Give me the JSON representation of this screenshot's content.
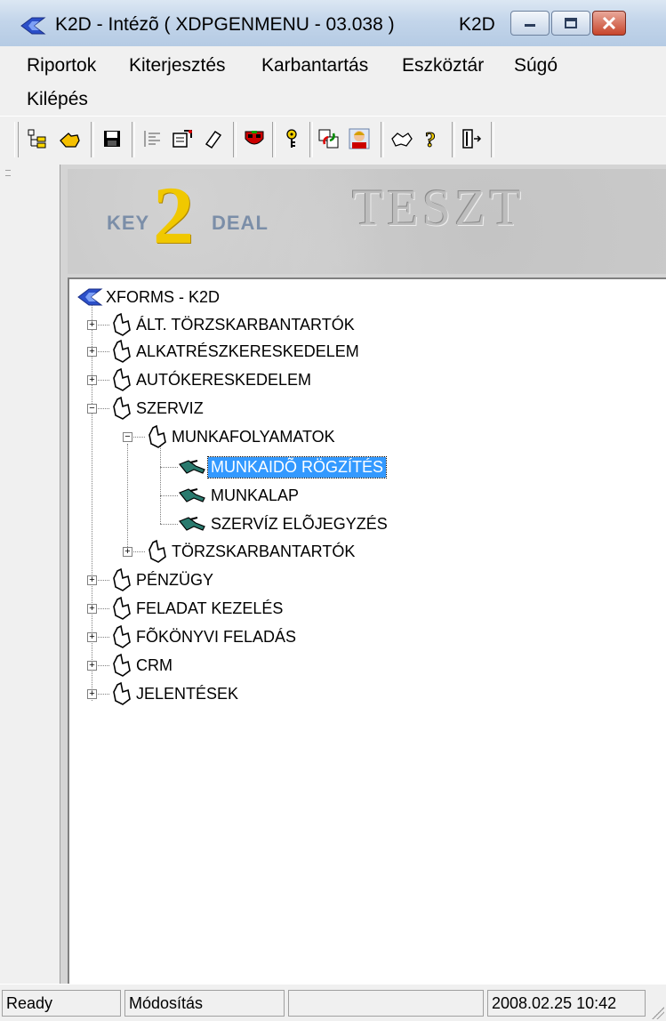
{
  "window": {
    "title": "K2D - Intézõ ( XDPGENMENU - 03.038 )",
    "title_extra": "K2D",
    "accent": "#3399ff"
  },
  "menu": {
    "items": [
      "Riportok",
      "Kiterjesztés",
      "Karbantartás",
      "Eszköztár",
      "Súgó",
      "Kilépés"
    ]
  },
  "toolbar": {
    "buttons": [
      "tree-view",
      "hand-pointer",
      "save",
      "align",
      "edit-window",
      "eraser",
      "mask",
      "key",
      "refresh",
      "user-portrait",
      "handshake",
      "help",
      "exit"
    ]
  },
  "banner": {
    "logo_key": "KEY",
    "logo_two": "2",
    "logo_deal": "DEAL",
    "environment": "TESZT"
  },
  "tree": {
    "root": "XFORMS - K2D",
    "nodes": [
      {
        "label": "ÁLT. TÖRZSKARBANTARTÓK",
        "expanded": false
      },
      {
        "label": "ALKATRÉSZKERESKEDELEM",
        "expanded": false
      },
      {
        "label": "AUTÓKERESKEDELEM",
        "expanded": false
      },
      {
        "label": "SZERVIZ",
        "expanded": true
      },
      {
        "label": "MUNKAFOLYAMATOK",
        "expanded": true
      },
      {
        "label": "MUNKAIDÕ RÖGZÍTÉS",
        "selected": true
      },
      {
        "label": "MUNKALAP"
      },
      {
        "label": "SZERVÍZ ELÕJEGYZÉS"
      },
      {
        "label": "TÖRZSKARBANTARTÓK",
        "expanded": false
      },
      {
        "label": "PÉNZÜGY",
        "expanded": false
      },
      {
        "label": "FELADAT KEZELÉS",
        "expanded": false
      },
      {
        "label": "FÕKÖNYVI FELADÁS",
        "expanded": false
      },
      {
        "label": "CRM",
        "expanded": false
      },
      {
        "label": "JELENTÉSEK",
        "expanded": false
      }
    ]
  },
  "status": {
    "state": "Ready",
    "mode": "Módosítás",
    "datetime": "2008.02.25 10:42"
  }
}
